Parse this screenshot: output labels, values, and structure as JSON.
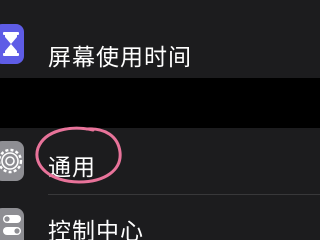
{
  "settings": {
    "items": [
      {
        "label": "屏幕使用时间",
        "icon": "hourglass-icon",
        "icon_color": "#5e5ce6"
      },
      {
        "label": "通用",
        "icon": "gear-icon",
        "icon_color": "#8e8e93"
      },
      {
        "label": "控制中心",
        "icon": "toggles-icon",
        "icon_color": "#8e8e93"
      }
    ]
  },
  "colors": {
    "background": "#000000",
    "cell": "#1c1c1e",
    "annotation": "#e8739a"
  }
}
